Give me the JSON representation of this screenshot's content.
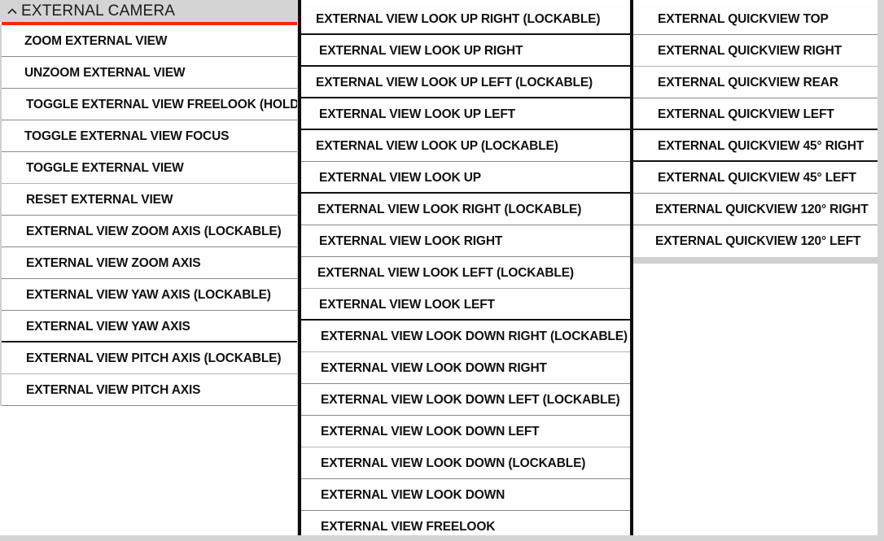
{
  "window": {
    "background_color": "#d4d4d4",
    "accent_color": "#ef2b0c",
    "panel_background": "#ffffff",
    "divider_color": "#8a8a8a"
  },
  "header": {
    "title": "EXTERNAL CAMERA",
    "collapse_icon": "chevron-up-icon",
    "accent_rule_color": "#ef2b0c"
  },
  "columns": {
    "left": {
      "name": "external-camera-controls",
      "items": [
        {
          "label": "ZOOM EXTERNAL VIEW",
          "indent": 28,
          "rule": "normal"
        },
        {
          "label": "UNZOOM EXTERNAL VIEW",
          "indent": 28,
          "rule": "normal"
        },
        {
          "label": "TOGGLE EXTERNAL VIEW FREELOOK (HOLD)",
          "indent": 30,
          "rule": "normal"
        },
        {
          "label": "TOGGLE EXTERNAL VIEW FOCUS",
          "indent": 28,
          "rule": "normal"
        },
        {
          "label": "TOGGLE EXTERNAL VIEW",
          "indent": 30,
          "rule": "faint"
        },
        {
          "label": "RESET EXTERNAL VIEW",
          "indent": 30,
          "rule": "normal"
        },
        {
          "label": "EXTERNAL VIEW ZOOM AXIS (LOCKABLE)",
          "indent": 30,
          "rule": "normal"
        },
        {
          "label": "EXTERNAL VIEW ZOOM AXIS",
          "indent": 30,
          "rule": "normal"
        },
        {
          "label": "EXTERNAL VIEW YAW AXIS (LOCKABLE)",
          "indent": 30,
          "rule": "normal"
        },
        {
          "label": "EXTERNAL VIEW YAW AXIS",
          "indent": 30,
          "rule": "thick"
        },
        {
          "label": "EXTERNAL VIEW PITCH AXIS (LOCKABLE)",
          "indent": 30,
          "rule": "faint"
        },
        {
          "label": "EXTERNAL VIEW PITCH AXIS",
          "indent": 30,
          "rule": "normal"
        }
      ]
    },
    "middle": {
      "name": "external-view-look-controls",
      "items": [
        {
          "label": "EXTERNAL VIEW LOOK UP RIGHT (LOCKABLE)",
          "indent": 18,
          "rule": "thick"
        },
        {
          "label": "EXTERNAL VIEW LOOK UP RIGHT",
          "indent": 22,
          "rule": "thick"
        },
        {
          "label": "EXTERNAL VIEW LOOK UP LEFT (LOCKABLE)",
          "indent": 18,
          "rule": "thick"
        },
        {
          "label": "EXTERNAL VIEW LOOK UP LEFT",
          "indent": 22,
          "rule": "thick"
        },
        {
          "label": "EXTERNAL VIEW LOOK UP (LOCKABLE)",
          "indent": 18,
          "rule": "normal"
        },
        {
          "label": "EXTERNAL VIEW LOOK UP",
          "indent": 22,
          "rule": "thick"
        },
        {
          "label": "EXTERNAL VIEW LOOK RIGHT (LOCKABLE)",
          "indent": 20,
          "rule": "normal"
        },
        {
          "label": "EXTERNAL VIEW LOOK RIGHT",
          "indent": 22,
          "rule": "normal"
        },
        {
          "label": "EXTERNAL VIEW LOOK LEFT (LOCKABLE)",
          "indent": 20,
          "rule": "faint"
        },
        {
          "label": "EXTERNAL VIEW LOOK LEFT",
          "indent": 22,
          "rule": "thick"
        },
        {
          "label": "EXTERNAL VIEW LOOK DOWN RIGHT (LOCKABLE)",
          "indent": 24,
          "rule": "faint"
        },
        {
          "label": "EXTERNAL VIEW LOOK DOWN RIGHT",
          "indent": 24,
          "rule": "normal"
        },
        {
          "label": "EXTERNAL VIEW LOOK DOWN LEFT (LOCKABLE)",
          "indent": 24,
          "rule": "normal"
        },
        {
          "label": "EXTERNAL VIEW LOOK DOWN LEFT",
          "indent": 24,
          "rule": "faint"
        },
        {
          "label": "EXTERNAL VIEW LOOK DOWN (LOCKABLE)",
          "indent": 24,
          "rule": "normal"
        },
        {
          "label": "EXTERNAL VIEW LOOK DOWN",
          "indent": 24,
          "rule": "normal"
        },
        {
          "label": "EXTERNAL VIEW FREELOOK",
          "indent": 24,
          "rule": "none"
        }
      ]
    },
    "right": {
      "name": "external-quickview-controls",
      "items": [
        {
          "label": "EXTERNAL QUICKVIEW TOP",
          "indent": 30,
          "rule": "normal"
        },
        {
          "label": "EXTERNAL QUICKVIEW RIGHT",
          "indent": 30,
          "rule": "faint"
        },
        {
          "label": "EXTERNAL QUICKVIEW REAR",
          "indent": 30,
          "rule": "normal"
        },
        {
          "label": "EXTERNAL QUICKVIEW LEFT",
          "indent": 30,
          "rule": "thick"
        },
        {
          "label": "EXTERNAL QUICKVIEW 45° RIGHT",
          "indent": 30,
          "rule": "thick"
        },
        {
          "label": "EXTERNAL QUICKVIEW 45° LEFT",
          "indent": 30,
          "rule": "normal"
        },
        {
          "label": "EXTERNAL QUICKVIEW 120° RIGHT",
          "indent": 27,
          "rule": "normal"
        },
        {
          "label": "EXTERNAL QUICKVIEW 120° LEFT",
          "indent": 27,
          "rule": "none"
        }
      ]
    }
  }
}
